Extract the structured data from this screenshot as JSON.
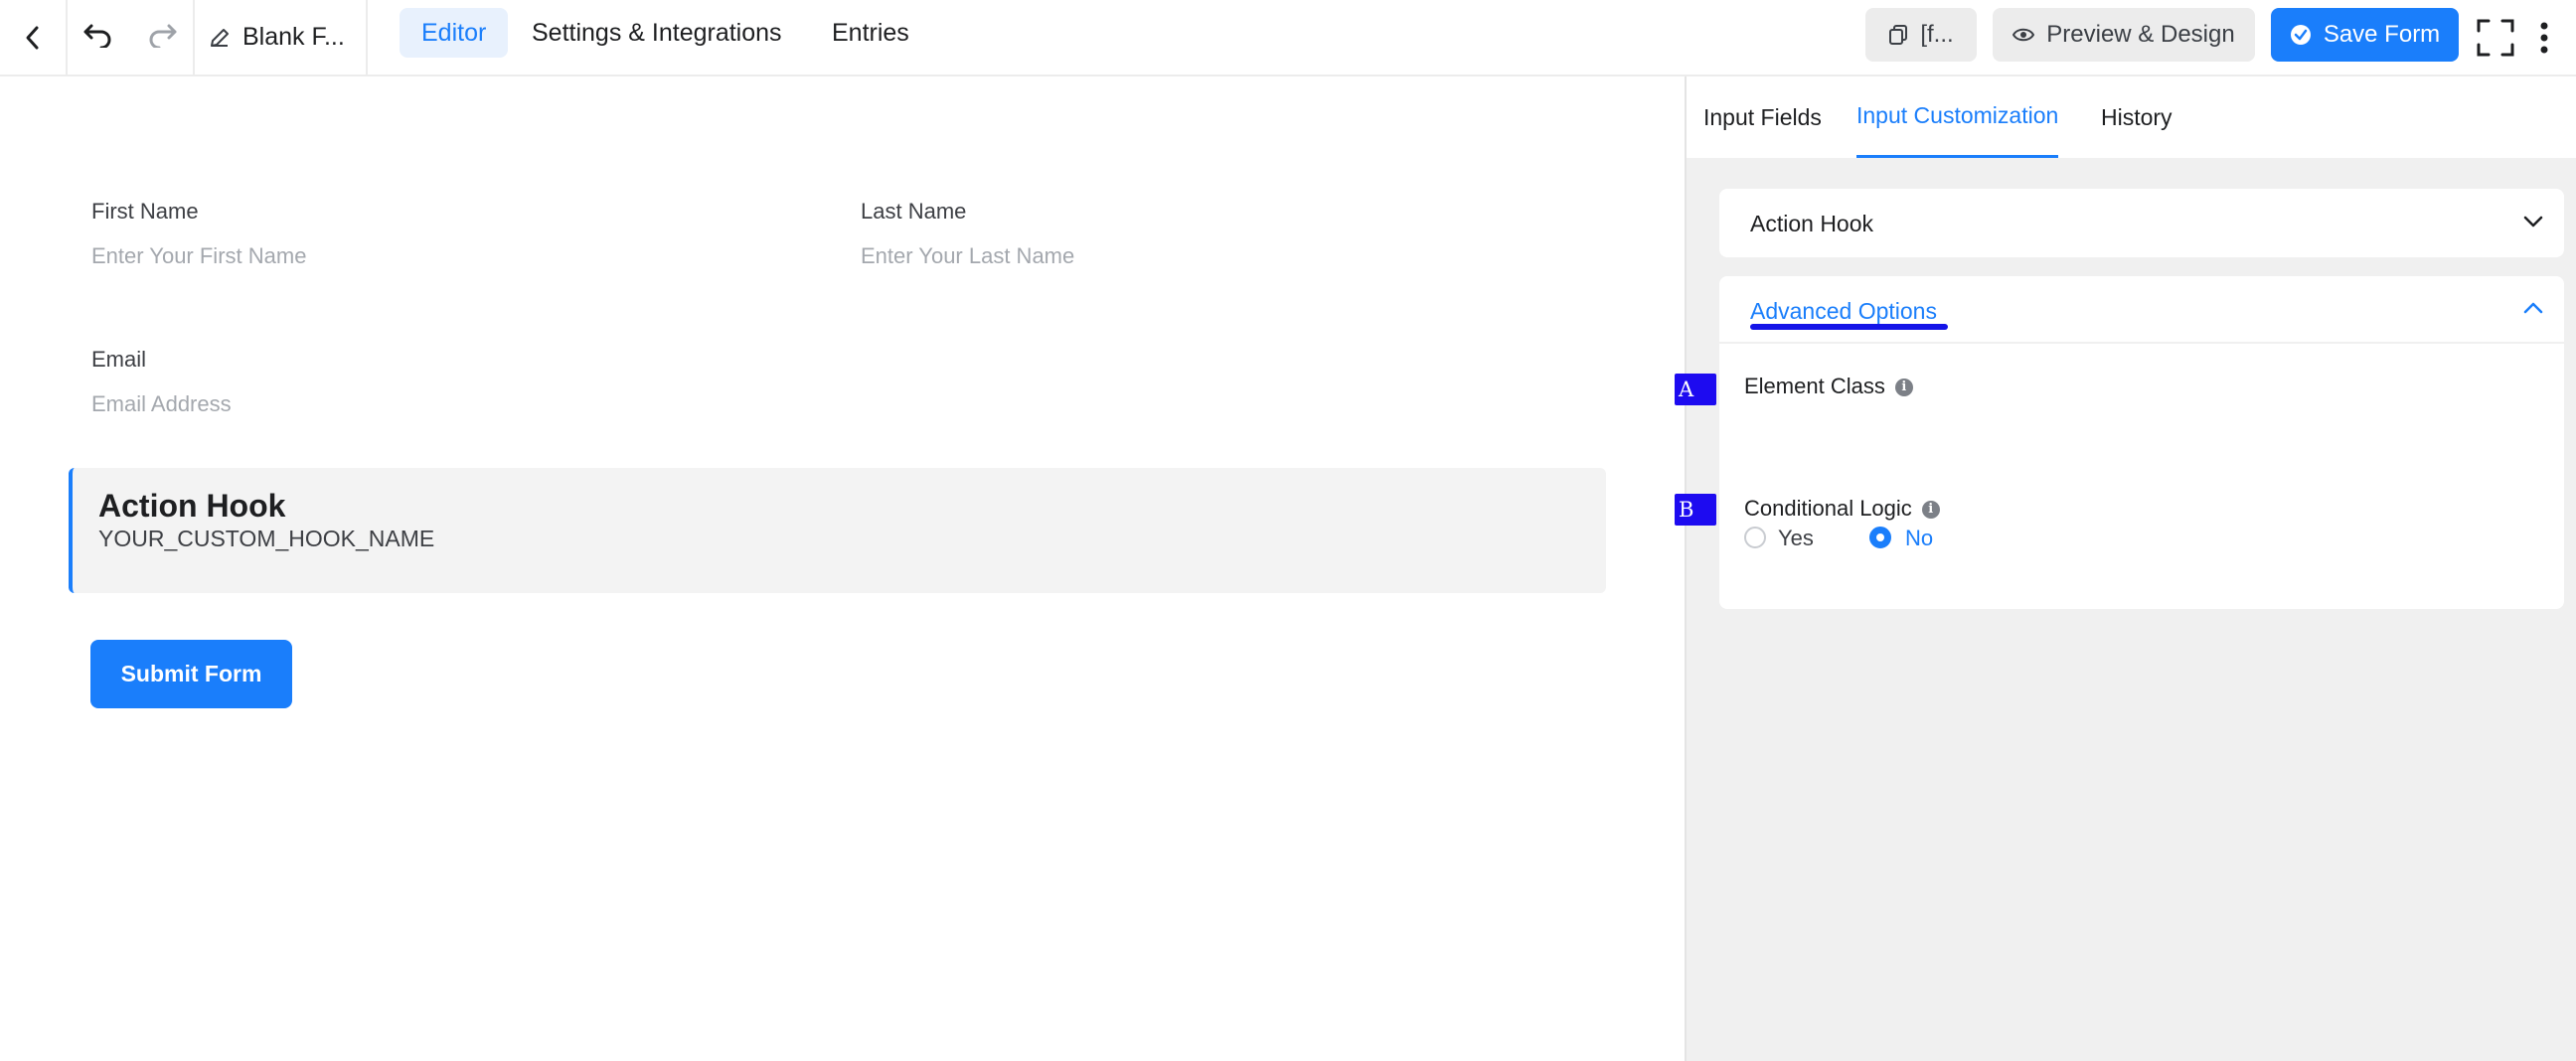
{
  "topbar": {
    "back_icon": "chevron-left-icon",
    "undo_icon": "undo-icon",
    "redo_icon": "redo-icon",
    "edit_icon": "pencil-icon",
    "form_title": "Blank F...",
    "tabs": [
      {
        "label": "Editor",
        "active": true
      },
      {
        "label": "Settings & Integrations",
        "active": false
      },
      {
        "label": "Entries",
        "active": false
      }
    ],
    "shortcode_label": "[f...",
    "preview_label": "Preview & Design",
    "save_label": "Save Form",
    "fullscreen_icon": "fullscreen-icon",
    "more_icon": "more-vertical-icon"
  },
  "form": {
    "first_name": {
      "label": "First Name",
      "placeholder": "Enter Your First Name"
    },
    "last_name": {
      "label": "Last Name",
      "placeholder": "Enter Your Last Name"
    },
    "email": {
      "label": "Email",
      "placeholder": "Email Address"
    },
    "hook": {
      "title": "Action Hook",
      "name": "YOUR_CUSTOM_HOOK_NAME"
    },
    "submit_label": "Submit Form"
  },
  "panel": {
    "tabs": [
      {
        "label": "Input Fields",
        "active": false
      },
      {
        "label": "Input Customization",
        "active": true
      },
      {
        "label": "History",
        "active": false
      }
    ],
    "action_hook_title": "Action Hook",
    "advanced_title": "Advanced Options",
    "element_class_label": "Element Class",
    "conditional_logic_label": "Conditional Logic",
    "radio_yes": "Yes",
    "radio_no": "No",
    "selected": "No"
  },
  "annotations": {
    "a": "A",
    "b": "B"
  },
  "colors": {
    "accent": "#1a7efb",
    "marker": "#1d0bf0",
    "panel_bg": "#f0f0f0"
  }
}
